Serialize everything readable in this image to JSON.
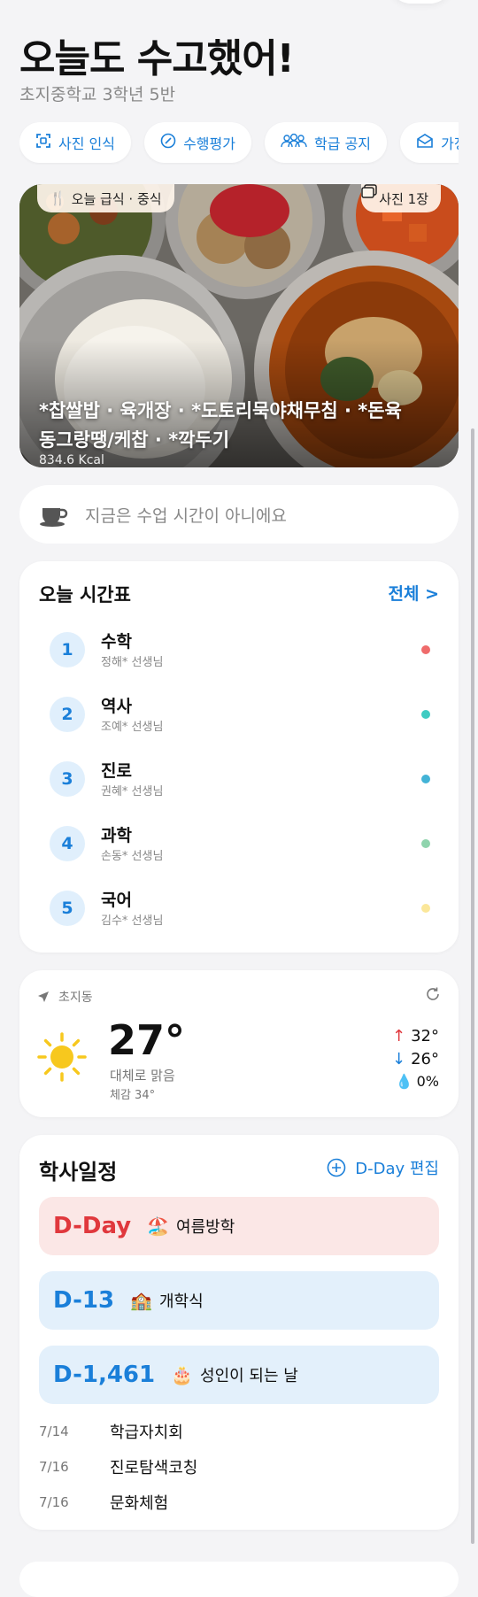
{
  "header": {
    "title": "오늘도 수고했어!",
    "school": "초지중학교 3학년 5반"
  },
  "chips": [
    {
      "label": "사진 인식",
      "icon": "scan-icon"
    },
    {
      "label": "수행평가",
      "icon": "check-circle-icon"
    },
    {
      "label": "학급 공지",
      "icon": "people-icon"
    },
    {
      "label": "가정",
      "icon": "envelope-icon"
    }
  ],
  "meal": {
    "tag_left": "오늘 급식 · 중식",
    "tag_right": "사진 1장",
    "menu": "*찹쌀밥 · 육개장 · *도토리묵야채무침 · *돈육동그랑땡/케찹 · *깍두기",
    "kcal": "834.6 Kcal"
  },
  "status": {
    "text": "지금은 수업 시간이 아니에요"
  },
  "timetable": {
    "title": "오늘 시간표",
    "all_label": "전체 >",
    "periods": [
      {
        "num": "1",
        "subject": "수학",
        "teacher": "정해* 선생님",
        "color": "#ef6b6b"
      },
      {
        "num": "2",
        "subject": "역사",
        "teacher": "조예* 선생님",
        "color": "#3ecbc2"
      },
      {
        "num": "3",
        "subject": "진로",
        "teacher": "권혜* 선생님",
        "color": "#43b3d6"
      },
      {
        "num": "4",
        "subject": "과학",
        "teacher": "손동* 선생님",
        "color": "#8fd4ad"
      },
      {
        "num": "5",
        "subject": "국어",
        "teacher": "김수* 선생님",
        "color": "#fbe79a"
      }
    ]
  },
  "weather": {
    "location": "초지동",
    "temp": "27°",
    "condition": "대체로 맑음",
    "feels": "체감 34°",
    "high": "32°",
    "low": "26°",
    "rain": "0%"
  },
  "academic": {
    "title": "학사일정",
    "edit_label": "D-Day 편집",
    "ddays": [
      {
        "value": "D-Day",
        "emoji": "🏖️",
        "name": "여름방학",
        "bg": "#fbe7e6",
        "color": "#e0383d"
      },
      {
        "value": "D-13",
        "emoji": "🏫",
        "name": "개학식",
        "bg": "#e3f0fb",
        "color": "#1a7fd9"
      },
      {
        "value": "D-1,461",
        "emoji": "🎂",
        "name": "성인이 되는 날",
        "bg": "#e3f0fb",
        "color": "#1a7fd9"
      }
    ],
    "schedule": [
      {
        "date": "7/14",
        "name": "학급자치회"
      },
      {
        "date": "7/16",
        "name": "진로탐색코칭"
      },
      {
        "date": "7/16",
        "name": "문화체험"
      }
    ]
  }
}
